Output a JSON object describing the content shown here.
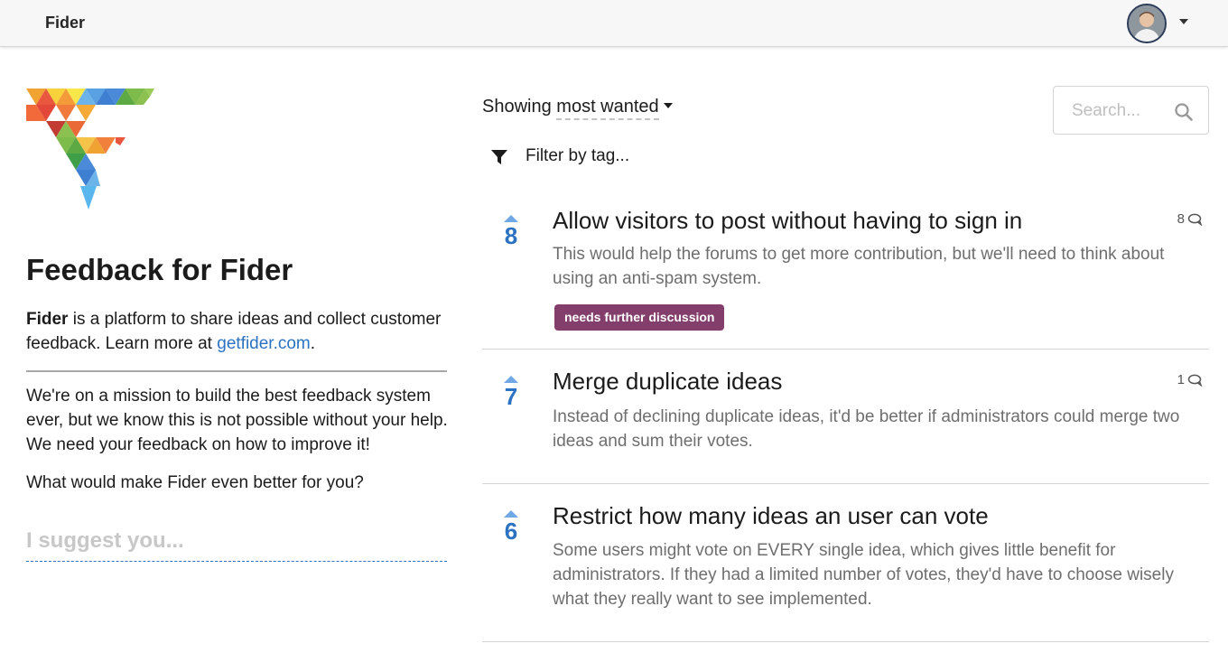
{
  "header": {
    "brand": "Fider"
  },
  "site": {
    "title": "Feedback for Fider",
    "intro_bold": "Fider",
    "intro_text": " is a platform to share ideas and collect customer feedback. Learn more at ",
    "intro_link": "getfider.com",
    "intro_end": ".",
    "mission": "We're on a mission to build the best feedback system ever, but we know this is not possible without your help. We need your feedback on how to improve it!",
    "question": "What would make Fider even better for you?",
    "suggest_placeholder": "I suggest you..."
  },
  "controls": {
    "showing_label": "Showing",
    "sort_value": "most wanted",
    "search_placeholder": "Search...",
    "filter_label": "Filter by tag..."
  },
  "ideas": [
    {
      "votes": "8",
      "title": "Allow visitors to post without having to sign in",
      "description": "This would help the forums to get more contribution, but we'll need to think about using an anti-spam system.",
      "comments": "8",
      "tag": "needs further discussion"
    },
    {
      "votes": "7",
      "title": "Merge duplicate ideas",
      "description": "Instead of declining duplicate ideas, it'd be better if administrators could merge two ideas and sum their votes.",
      "comments": "1"
    },
    {
      "votes": "6",
      "title": "Restrict how many ideas an user can vote",
      "description": "Some users might vote on EVERY single idea, which gives little benefit for administrators. If they had a limited number of votes, they'd have to choose wisely what they really want to see implemented."
    }
  ],
  "colors": {
    "accent": "#2b72c2",
    "tag": "#833e6c",
    "vote_arrow": "#70a8e6"
  }
}
